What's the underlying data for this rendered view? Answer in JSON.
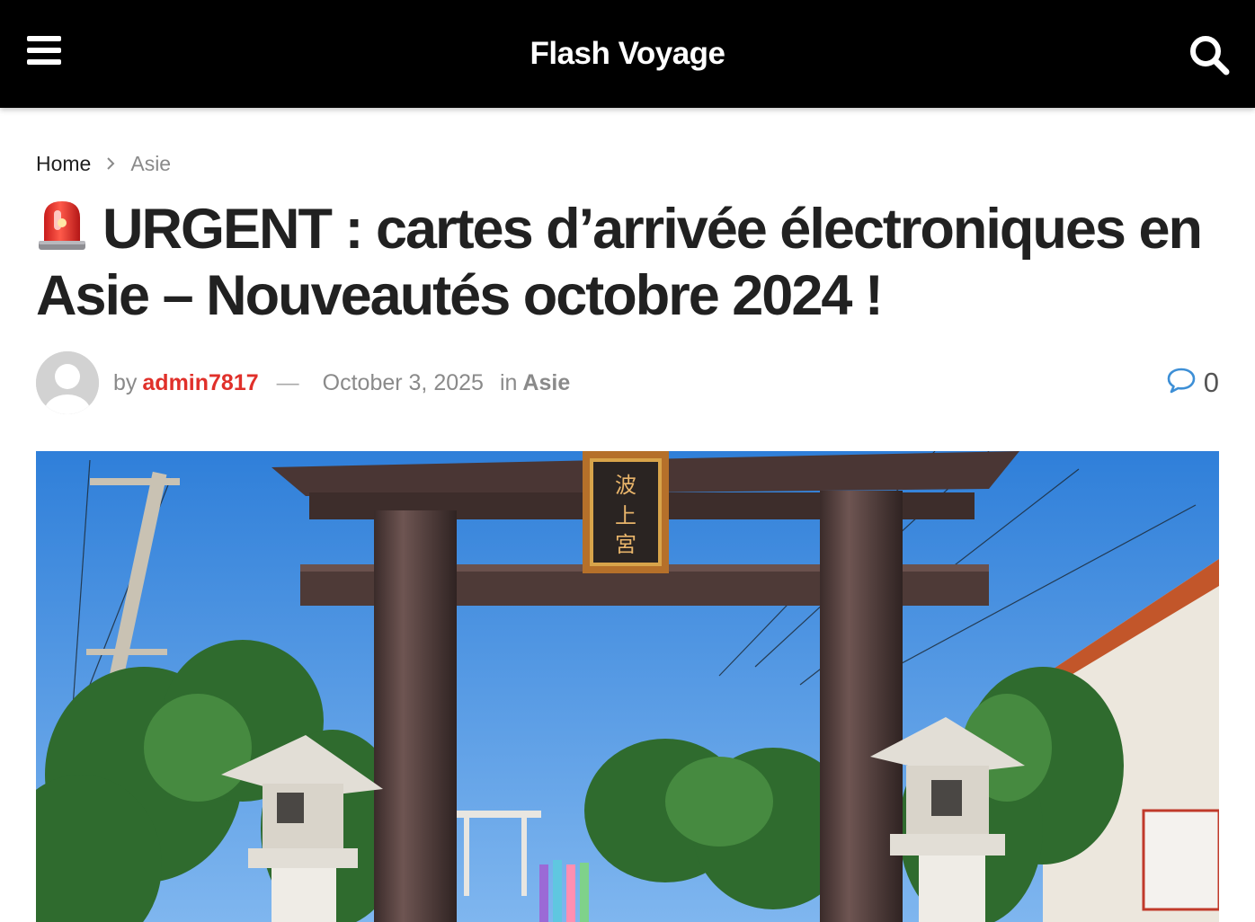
{
  "header": {
    "site_title": "Flash Voyage",
    "menu_icon": "hamburger-icon",
    "search_icon": "search-icon",
    "background": "#000000"
  },
  "breadcrumb": {
    "home": "Home",
    "separator_icon": "chevron-right-icon",
    "current": "Asie"
  },
  "article": {
    "emoji": "siren-emoji",
    "title": "URGENT : cartes d’arrivée électroniques en Asie – Nouveautés octobre 2024 !",
    "meta": {
      "by_label": "by",
      "author": "admin7817",
      "separator": "—",
      "date": "October 3, 2025",
      "in_label": "in",
      "category": "Asie",
      "comment_icon": "comment-icon",
      "comment_count": "0"
    },
    "hero_image": {
      "description_icon": "torii-gate-photo",
      "plaque_text": [
        "波",
        "上",
        "宮"
      ]
    }
  },
  "colors": {
    "accent_author": "#e0302a",
    "comment_icon": "#3d8fd6",
    "text": "#212121",
    "muted": "#8a8a8a"
  }
}
